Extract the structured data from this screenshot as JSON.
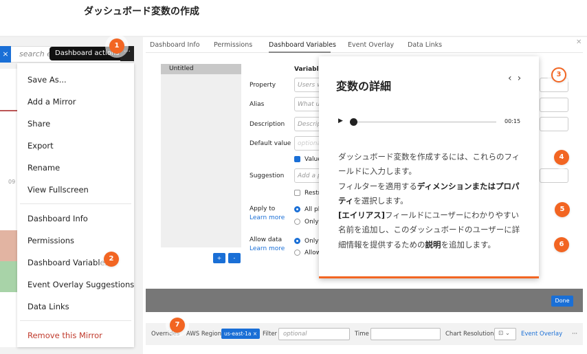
{
  "page_title": "ダッシュボード変数の作成",
  "dashboard": {
    "search_placeholder": "search e",
    "tooltip": "Dashboard actions",
    "more_icon": "ellipsis",
    "close_icon": "close",
    "axis_label": "09"
  },
  "menu": {
    "items": [
      "Save As...",
      "Add a Mirror",
      "Share",
      "Export",
      "Rename",
      "View Fullscreen",
      "Dashboard Info",
      "Permissions",
      "Dashboard Variables",
      "Event Overlay Suggestions",
      "Data Links"
    ],
    "danger_item": "Remove this Mirror",
    "danger_color": "#c0392b"
  },
  "modal": {
    "tabs": [
      "Dashboard Info",
      "Permissions",
      "Dashboard Variables",
      "Event Overlay",
      "Data Links"
    ],
    "active_tab": "Dashboard Variables",
    "list_item": "Untitled",
    "add_label": "+",
    "remove_label": "-",
    "variable_header": "Variable I",
    "fields": {
      "property": {
        "label": "Property",
        "placeholder": "Users w"
      },
      "alias": {
        "label": "Alias",
        "placeholder": "What u"
      },
      "description": {
        "label": "Description",
        "placeholder": "Descrip"
      },
      "default_value": {
        "label": "Default value",
        "placeholder": "optiona"
      },
      "value_required": {
        "label": "Value",
        "checked": true
      },
      "suggestion": {
        "label": "Suggestion",
        "placeholder": "Add a p"
      },
      "restrict": {
        "label": "Restr",
        "checked": false
      },
      "apply_to": {
        "label": "Apply to",
        "learn_more": "Learn more",
        "options": [
          "All pl",
          "Only p"
        ],
        "selected": 0
      },
      "allow_data": {
        "label": "Allow data",
        "learn_more": "Learn more",
        "options": [
          "Only a",
          "Allow"
        ],
        "selected": 0
      }
    },
    "done_label": "Done"
  },
  "bottom_bar": {
    "overrides": "Overrides",
    "aws_region": "AWS Region",
    "region_chip": "us-east-1a ×",
    "filter_label": "Filter",
    "filter_placeholder": "optional",
    "time_label": "Time",
    "chart_resolution": "Chart Resolution",
    "event_overlay": "Event Overlay",
    "more": "···"
  },
  "popup": {
    "title": "変数の詳細",
    "nav_prev": "‹",
    "nav_next": "›",
    "audio_time": "00:15",
    "audio_progress": 0,
    "lines": [
      [
        "ダッシュボード変数を作成するには、これらのフィールドに入力します。"
      ],
      [
        "フィルターを適用する",
        "ディメンションまたはプロパティ",
        "を選択します。"
      ],
      [
        "[エイリアス]",
        "フィールドにユーザーにわかりやすい名前を追加し、このダッシュボードのユーザーに詳細情報を提供するための",
        "説明",
        "を追加します。"
      ]
    ]
  },
  "badges": [
    "1",
    "2",
    "3",
    "4",
    "5",
    "6",
    "7"
  ],
  "colors": {
    "accent": "#1a6fd6",
    "badge": "#f26522"
  }
}
